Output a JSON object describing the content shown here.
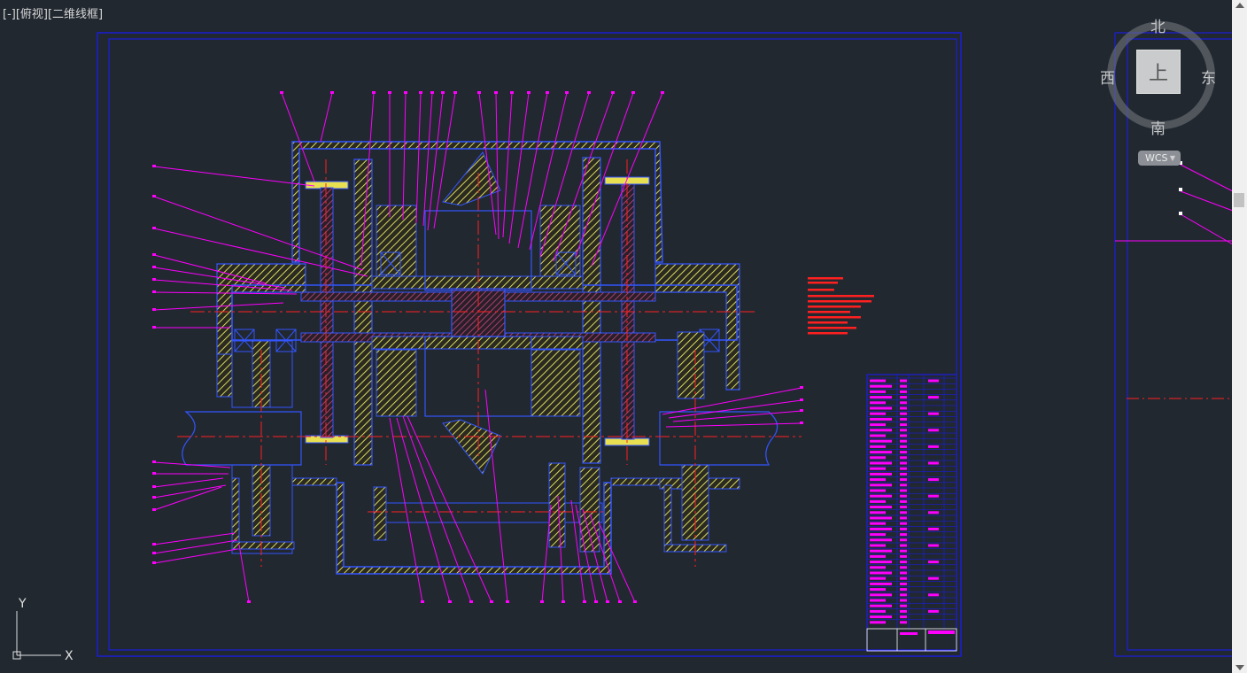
{
  "viewport": {
    "label": "[-][俯视][二维线框]"
  },
  "viewcube": {
    "north": "北",
    "south": "南",
    "east": "东",
    "west": "西",
    "face": "上"
  },
  "wcs": {
    "label": "WCS",
    "menu_icon": "chevron-down-icon"
  },
  "ucs": {
    "x_label": "X",
    "y_label": "Y"
  },
  "colors": {
    "background": "#212830",
    "frame": "#1a1aff",
    "outline": "#3355ff",
    "hatch": "#d8d860",
    "leader": "#ff00ff",
    "centerline": "#ff2020"
  }
}
